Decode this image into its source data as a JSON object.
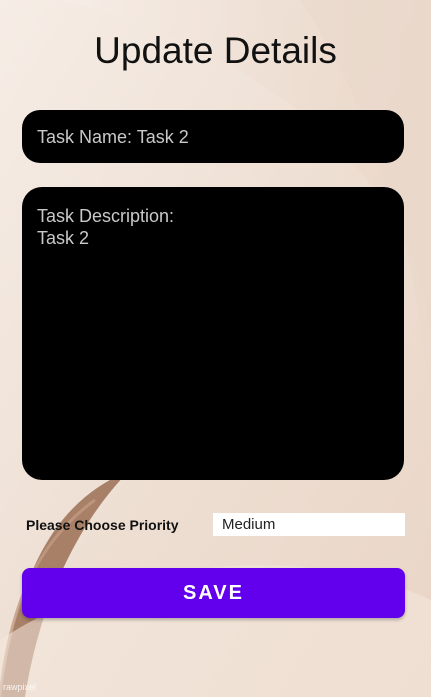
{
  "page": {
    "title": "Update Details"
  },
  "form": {
    "task_name_value": "Task Name: Task 2",
    "task_description_value": "Task Description:\nTask 2",
    "priority_label": "Please Choose Priority",
    "priority_selected": "Medium",
    "save_label": "SAVE"
  },
  "watermark": "rawpixel",
  "colors": {
    "accent": "#6200ee",
    "field_background": "#000000",
    "page_background": "#f1e4da"
  }
}
